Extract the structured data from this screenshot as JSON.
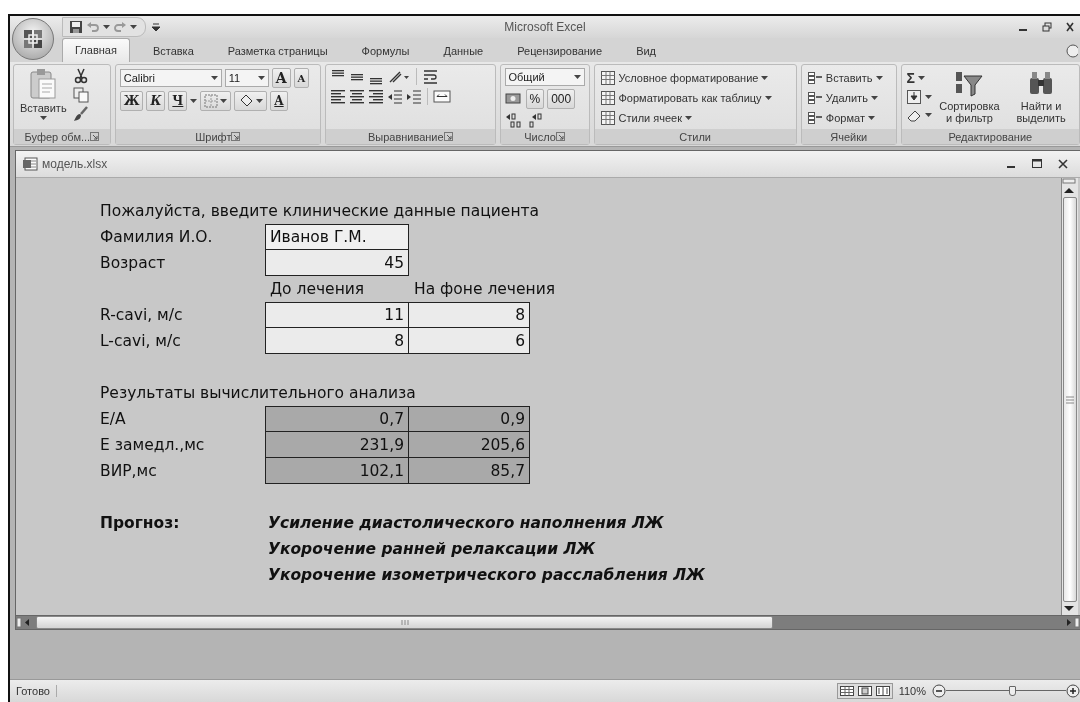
{
  "window": {
    "title": "Microsoft Excel"
  },
  "ribbon": {
    "tabs": [
      {
        "label": "Главная",
        "selected": true
      },
      {
        "label": "Вставка",
        "selected": false
      },
      {
        "label": "Разметка страницы",
        "selected": false
      },
      {
        "label": "Формулы",
        "selected": false
      },
      {
        "label": "Данные",
        "selected": false
      },
      {
        "label": "Рецензирование",
        "selected": false
      },
      {
        "label": "Вид",
        "selected": false
      }
    ],
    "groups": [
      {
        "kind": "clipboard",
        "label": "Буфер обм...",
        "launcher": true,
        "paste": "Вставить"
      },
      {
        "kind": "font",
        "label": "Шрифт",
        "launcher": true,
        "font_name": "Calibri",
        "font_size": "11",
        "grow": "A",
        "shrink": "A",
        "styles": [
          "Ж",
          "К",
          "Ч"
        ],
        "font_color": "A"
      },
      {
        "kind": "alignment",
        "label": "Выравнивание",
        "launcher": true
      },
      {
        "kind": "number",
        "label": "Число",
        "launcher": true,
        "format": "Общий",
        "buttons": [
          "%",
          "000"
        ]
      },
      {
        "kind": "styles",
        "label": "Стили",
        "launcher": false,
        "buttons": [
          "Условное форматирование",
          "Форматировать как таблицу",
          "Стили ячеек"
        ]
      },
      {
        "kind": "cells",
        "label": "Ячейки",
        "launcher": false,
        "buttons": [
          "Вставить",
          "Удалить",
          "Формат"
        ]
      },
      {
        "kind": "editing",
        "label": "Редактирование",
        "launcher": false,
        "sum": "Σ",
        "buttons": [
          "Сортировка и фильтр",
          "Найти и выделить"
        ]
      }
    ]
  },
  "document": {
    "title": "модель.xlsx"
  },
  "sheet": {
    "prompt": "Пожалуйста, введите клинические данные пациента",
    "patient": [
      {
        "label": "Фамилия И.О.",
        "value": "Иванов Г.М.",
        "kind": "text"
      },
      {
        "label": "Возраст",
        "value": "45",
        "kind": "number"
      }
    ],
    "column_headers": [
      "До лечения",
      "На фоне лечения"
    ],
    "inputs": [
      {
        "label": "R-cavi, м/с",
        "values": [
          "11",
          "8"
        ]
      },
      {
        "label": "L-cavi, м/с",
        "values": [
          "8",
          "6"
        ]
      }
    ],
    "results_title": "Результаты вычислительного анализа",
    "results": [
      {
        "label": "E/A",
        "values": [
          "0,7",
          "0,9"
        ]
      },
      {
        "label": "E замедл.,мс",
        "values": [
          "231,9",
          "205,6"
        ]
      },
      {
        "label": "ВИР,мс",
        "values": [
          "102,1",
          "85,7"
        ]
      }
    ],
    "prognosis": {
      "label": "Прогноз:",
      "lines": [
        "Усиление диастолического наполнения ЛЖ",
        "Укорочение ранней релаксации ЛЖ",
        "Укорочение изометрического расслабления ЛЖ"
      ]
    }
  },
  "status_bar": {
    "status": "Готово",
    "zoom": "110%",
    "zoom_slider": {
      "level": 0.55
    }
  }
}
